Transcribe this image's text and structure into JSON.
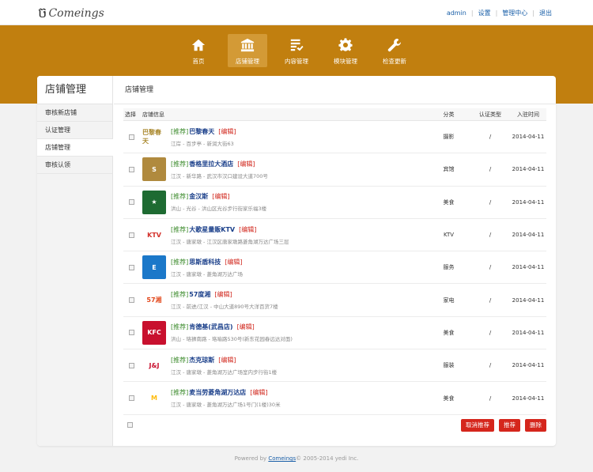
{
  "brand": {
    "mark": "ច",
    "name": "Comeings"
  },
  "top_links": [
    {
      "label": "admin"
    },
    {
      "label": "设置"
    },
    {
      "label": "管理中心"
    },
    {
      "label": "退出"
    }
  ],
  "nav": [
    {
      "label": "首页",
      "icon": "home-icon"
    },
    {
      "label": "店铺管理",
      "icon": "building-icon",
      "active": true
    },
    {
      "label": "内容管理",
      "icon": "list-check-icon"
    },
    {
      "label": "模块管理",
      "icon": "gear-icon"
    },
    {
      "label": "检查更新",
      "icon": "wrench-icon"
    }
  ],
  "sidebar": {
    "title": "店铺管理",
    "items": [
      {
        "label": "审核新店铺"
      },
      {
        "label": "认证管理"
      },
      {
        "label": "店铺管理",
        "active": true
      },
      {
        "label": "审核认领"
      }
    ]
  },
  "main": {
    "title": "店铺管理",
    "columns": {
      "select": "选择",
      "info": "店铺信息",
      "category": "分类",
      "auth": "认证类型",
      "date": "入驻时间"
    },
    "rows": [
      {
        "tag": "[推荐]",
        "name": "巴黎春天",
        "edit": "[编辑]",
        "addr": "江岸 - 百步亭 - 新润大街63",
        "category": "摄影",
        "auth": "/",
        "date": "2014-04-11",
        "logo_text": "巴黎春天",
        "logo_bg": "#ffffff",
        "logo_color": "#a8862a"
      },
      {
        "tag": "[推荐]",
        "name": "香格里拉大酒店",
        "edit": "[编辑]",
        "addr": "江汉 - 新华路 - 武汉市汉口建设大道700号",
        "category": "宾馆",
        "auth": "/",
        "date": "2014-04-11",
        "logo_text": "S",
        "logo_bg": "#b08a3e",
        "logo_color": "#ffffff"
      },
      {
        "tag": "[推荐]",
        "name": "金汉斯",
        "edit": "[编辑]",
        "addr": "洪山 - 光谷 - 洪山区光谷步行街家乐福3楼",
        "category": "美食",
        "auth": "/",
        "date": "2014-04-11",
        "logo_text": "★",
        "logo_bg": "#1e6b32",
        "logo_color": "#ffffff"
      },
      {
        "tag": "[推荐]",
        "name": "大歌星量贩KTV",
        "edit": "[编辑]",
        "addr": "江汉 - 唐家墩 - 江汉区唐家墩路菱角湖万达广场三层",
        "category": "KTV",
        "auth": "/",
        "date": "2014-04-11",
        "logo_text": "KTV",
        "logo_bg": "#ffffff",
        "logo_color": "#d3302a"
      },
      {
        "tag": "[推荐]",
        "name": "思斯盾科技",
        "edit": "[编辑]",
        "addr": "江汉 - 唐家墩 - 菱角湖万达广场",
        "category": "服务",
        "auth": "/",
        "date": "2014-04-11",
        "logo_text": "E",
        "logo_bg": "#1b78c9",
        "logo_color": "#ffffff"
      },
      {
        "tag": "[推荐]",
        "name": "57度湘",
        "edit": "[编辑]",
        "addr": "江汉 - 前进/江汉 - 中山大道890号大洋百货7楼",
        "category": "家电",
        "auth": "/",
        "date": "2014-04-11",
        "logo_text": "57湘",
        "logo_bg": "#ffffff",
        "logo_color": "#e2471b"
      },
      {
        "tag": "[推荐]",
        "name": "肯德基(武昌店)",
        "edit": "[编辑]",
        "addr": "洪山 - 珞狮南路 - 珞喻路530号(新东花园春远达对面)",
        "category": "美食",
        "auth": "/",
        "date": "2014-04-11",
        "logo_text": "KFC",
        "logo_bg": "#c8102e",
        "logo_color": "#ffffff"
      },
      {
        "tag": "[推荐]",
        "name": "杰克琼斯",
        "edit": "[编辑]",
        "addr": "江汉 - 唐家墩 - 菱角湖万达广场室内步行街1楼",
        "category": "服装",
        "auth": "/",
        "date": "2014-04-11",
        "logo_text": "J&J",
        "logo_bg": "#ffffff",
        "logo_color": "#c8102e"
      },
      {
        "tag": "[推荐]",
        "name": "麦当劳菱角湖万达店",
        "edit": "[编辑]",
        "addr": "江汉 - 唐家墩 - 菱角湖万达广场1号门(1楼)30米",
        "category": "美食",
        "auth": "/",
        "date": "2014-04-11",
        "logo_text": "M",
        "logo_bg": "#ffffff",
        "logo_color": "#ffbc0d"
      }
    ],
    "buttons": {
      "cancel_recommend": "取消推荐",
      "recommend": "推荐",
      "delete": "删除"
    }
  },
  "footer": {
    "prefix": "Powered by ",
    "link": "Comeings",
    "suffix": "© 2005-2014 yedi Inc."
  },
  "colors": {
    "accent": "#c17f0f",
    "danger": "#d5261c",
    "link": "#1a5fa8"
  }
}
